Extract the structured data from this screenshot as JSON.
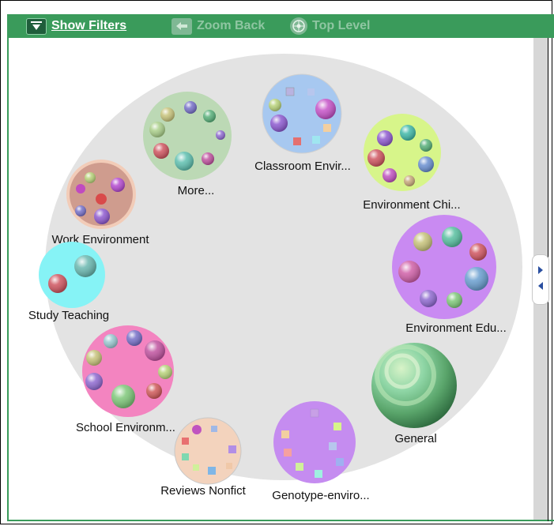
{
  "toolbar": {
    "show_filters": "Show Filters",
    "zoom_back": "Zoom Back",
    "top_level": "Top Level"
  },
  "clusters": [
    {
      "label": "Classroom Envir...",
      "color": "#a7c8f0"
    },
    {
      "label": "More...",
      "color": "#bcd9b5"
    },
    {
      "label": "Environment Chi...",
      "color": "#d7f58a"
    },
    {
      "label": "Work Environment",
      "color": "#cf9c8e"
    },
    {
      "label": "Environment Edu...",
      "color": "#c98af2"
    },
    {
      "label": "Study Teaching",
      "color": "#86f3f6"
    },
    {
      "label": "General",
      "color": "#6fb372"
    },
    {
      "label": "School Environm...",
      "color": "#f384c0"
    },
    {
      "label": "Reviews Nonfict",
      "color": "#f3d3bd"
    },
    {
      "label": "Genotype-enviro...",
      "color": "#c58cf0"
    }
  ],
  "colors": {
    "toolbar_bg": "#3a9b5b",
    "outer_circle": "#e3e3e3"
  }
}
